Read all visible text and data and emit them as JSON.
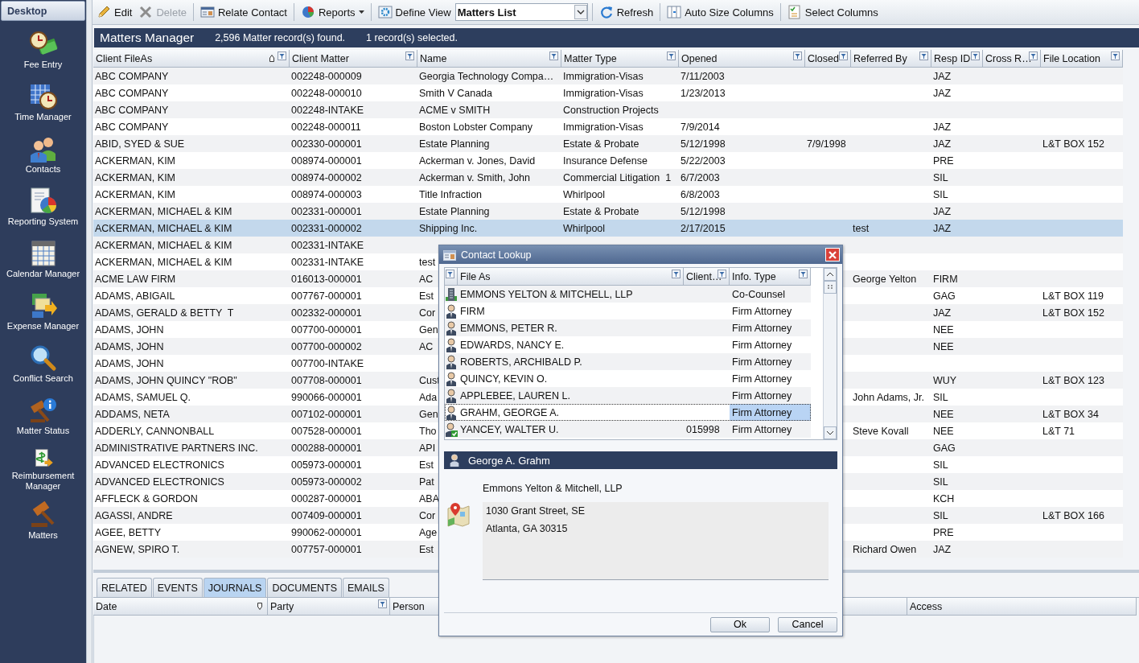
{
  "sidebar": {
    "header": "Desktop",
    "items": [
      {
        "label": "Fee Entry"
      },
      {
        "label": "Time Manager"
      },
      {
        "label": "Contacts"
      },
      {
        "label": "Reporting System"
      },
      {
        "label": "Calendar Manager"
      },
      {
        "label": "Expense Manager"
      },
      {
        "label": "Conflict Search"
      },
      {
        "label": "Matter Status"
      },
      {
        "label": "Reimbursement Manager"
      },
      {
        "label": "Matters"
      }
    ]
  },
  "toolbar": [
    {
      "kind": "button",
      "label": "Edit",
      "disabled": false
    },
    {
      "kind": "button",
      "label": "Delete",
      "disabled": true
    },
    {
      "kind": "button",
      "label": "Relate Contact",
      "disabled": false
    },
    {
      "kind": "dropdown",
      "label": "Reports",
      "disabled": false
    },
    {
      "kind": "button",
      "label": "Define View",
      "disabled": false
    },
    {
      "kind": "combo",
      "label": "Matters List",
      "disabled": false
    },
    {
      "kind": "button",
      "label": "Refresh",
      "disabled": false
    },
    {
      "kind": "button",
      "label": "Auto Size Columns",
      "disabled": false
    },
    {
      "kind": "button",
      "label": "Select Columns",
      "disabled": false
    }
  ],
  "header": {
    "title": "Matters Manager",
    "found": "2,596 Matter record(s) found.",
    "selected": "1 record(s) selected."
  },
  "table": {
    "columns": [
      {
        "label": "Client FileAs",
        "sorted": true
      },
      {
        "label": "Client Matter",
        "sorted": false
      },
      {
        "label": "Name",
        "sorted": false
      },
      {
        "label": "Matter Type",
        "sorted": false
      },
      {
        "label": "Opened",
        "sorted": false
      },
      {
        "label": "Closed",
        "sorted": false
      },
      {
        "label": "Referred By",
        "sorted": false
      },
      {
        "label": "Resp ID",
        "sorted": false
      },
      {
        "label": "Cross R…",
        "sorted": false
      },
      {
        "label": "File Location",
        "sorted": false
      }
    ],
    "rows": [
      {
        "selected": false,
        "cells": [
          "ABC COMPANY",
          "002248-000009",
          "Georgia Technology Compa…",
          "Immigration-Visas",
          "7/11/2003",
          "",
          "",
          "JAZ",
          "",
          ""
        ]
      },
      {
        "selected": false,
        "cells": [
          "ABC COMPANY",
          "002248-000010",
          "Smith V Canada",
          "Immigration-Visas",
          "1/23/2013",
          "",
          "",
          "JAZ",
          "",
          ""
        ]
      },
      {
        "selected": false,
        "cells": [
          "ABC COMPANY",
          "002248-INTAKE",
          "ACME v SMITH",
          "Construction Projects",
          "",
          "",
          "",
          "",
          "",
          ""
        ]
      },
      {
        "selected": false,
        "cells": [
          "ABC COMPANY",
          "002248-000011",
          "Boston Lobster Company",
          "Immigration-Visas",
          "7/9/2014",
          "",
          "",
          "JAZ",
          "",
          ""
        ]
      },
      {
        "selected": false,
        "cells": [
          "ABID, SYED & SUE",
          "002330-000001",
          "Estate Planning",
          "Estate & Probate",
          "5/12/1998",
          "7/9/1998",
          "",
          "JAZ",
          "",
          "L&T BOX 152"
        ]
      },
      {
        "selected": false,
        "cells": [
          "ACKERMAN, KIM",
          "008974-000001",
          "Ackerman v. Jones, David",
          "Insurance Defense",
          "5/22/2003",
          "",
          "",
          "PRE",
          "",
          ""
        ]
      },
      {
        "selected": false,
        "cells": [
          "ACKERMAN, KIM",
          "008974-000002",
          "Ackerman v. Smith, John",
          "Commercial Litigation  1",
          "6/7/2003",
          "",
          "",
          "SIL",
          "",
          ""
        ]
      },
      {
        "selected": false,
        "cells": [
          "ACKERMAN, KIM",
          "008974-000003",
          "Title Infraction",
          "Whirlpool",
          "6/8/2003",
          "",
          "",
          "SIL",
          "",
          ""
        ]
      },
      {
        "selected": false,
        "cells": [
          "ACKERMAN, MICHAEL & KIM",
          "002331-000001",
          "Estate Planning",
          "Estate & Probate",
          "5/12/1998",
          "",
          "",
          "JAZ",
          "",
          ""
        ]
      },
      {
        "selected": true,
        "cells": [
          "ACKERMAN, MICHAEL & KIM",
          "002331-000002",
          "Shipping Inc.",
          "Whirlpool",
          "2/17/2015",
          "",
          "test",
          "JAZ",
          "",
          ""
        ]
      },
      {
        "selected": false,
        "cells": [
          "ACKERMAN, MICHAEL & KIM",
          "002331-INTAKE",
          "",
          "",
          "",
          "",
          "",
          "",
          "",
          ""
        ]
      },
      {
        "selected": false,
        "cells": [
          "ACKERMAN, MICHAEL & KIM",
          "002331-INTAKE",
          "test",
          "",
          "",
          "",
          "",
          "",
          "",
          ""
        ]
      },
      {
        "selected": false,
        "cells": [
          "ACME LAW FIRM",
          "016013-000001",
          "AC",
          "",
          "",
          "",
          "George Yelton",
          "FIRM",
          "",
          ""
        ]
      },
      {
        "selected": false,
        "cells": [
          "ADAMS, ABIGAIL",
          "007767-000001",
          "Est",
          "",
          "",
          "",
          "",
          "GAG",
          "",
          "L&T BOX 119"
        ]
      },
      {
        "selected": false,
        "cells": [
          "ADAMS, GERALD & BETTY  T",
          "002332-000001",
          "Cor",
          "",
          "",
          "",
          "",
          "JAZ",
          "",
          "L&T BOX 152"
        ]
      },
      {
        "selected": false,
        "cells": [
          "ADAMS, JOHN",
          "007700-000001",
          "Gen",
          "",
          "",
          "",
          "",
          "NEE",
          "",
          ""
        ]
      },
      {
        "selected": false,
        "cells": [
          "ADAMS, JOHN",
          "007700-000002",
          "AC",
          "",
          "",
          "",
          "",
          "NEE",
          "",
          ""
        ]
      },
      {
        "selected": false,
        "cells": [
          "ADAMS, JOHN",
          "007700-INTAKE",
          "",
          "",
          "",
          "",
          "",
          "",
          "",
          ""
        ]
      },
      {
        "selected": false,
        "cells": [
          "ADAMS, JOHN QUINCY \"ROB\"",
          "007708-000001",
          "Cust",
          "",
          "",
          "",
          "",
          "WUY",
          "",
          "L&T BOX 123"
        ]
      },
      {
        "selected": false,
        "cells": [
          "ADAMS, SAMUEL Q.",
          "990066-000001",
          "Ada",
          "",
          "",
          "",
          "John Adams, Jr.",
          "SIL",
          "",
          ""
        ]
      },
      {
        "selected": false,
        "cells": [
          "ADDAMS, NETA",
          "007102-000001",
          "Gen",
          "",
          "",
          "",
          "",
          "NEE",
          "",
          "L&T BOX 34"
        ]
      },
      {
        "selected": false,
        "cells": [
          "ADDERLY, CANNONBALL",
          "007528-000001",
          "Tho",
          "",
          "",
          "",
          "Steve Kovall",
          "NEE",
          "",
          "L&T 71"
        ]
      },
      {
        "selected": false,
        "cells": [
          "ADMINISTRATIVE PARTNERS INC.",
          "000288-000001",
          "API",
          "",
          "",
          "",
          "",
          "GAG",
          "",
          ""
        ]
      },
      {
        "selected": false,
        "cells": [
          "ADVANCED ELECTRONICS",
          "005973-000001",
          "Est",
          "",
          "",
          "",
          "",
          "SIL",
          "",
          ""
        ]
      },
      {
        "selected": false,
        "cells": [
          "ADVANCED ELECTRONICS",
          "005973-000002",
          "Pat",
          "",
          "",
          "",
          "",
          "SIL",
          "",
          ""
        ]
      },
      {
        "selected": false,
        "cells": [
          "AFFLECK & GORDON",
          "000287-000001",
          "ABA",
          "",
          "",
          "",
          "",
          "KCH",
          "",
          ""
        ]
      },
      {
        "selected": false,
        "cells": [
          "AGASSI, ANDRE",
          "007409-000001",
          "Cor",
          "",
          "",
          "",
          "",
          "SIL",
          "",
          "L&T BOX 166"
        ]
      },
      {
        "selected": false,
        "cells": [
          "AGEE, BETTY",
          "990062-000001",
          "Age",
          "",
          "",
          "",
          "",
          "PRE",
          "",
          ""
        ]
      },
      {
        "selected": false,
        "cells": [
          "AGNEW, SPIRO T.",
          "007757-000001",
          "Est",
          "",
          "",
          "",
          "Richard Owen",
          "JAZ",
          "",
          ""
        ]
      }
    ]
  },
  "tabs": [
    {
      "label": "RELATED",
      "selected": false
    },
    {
      "label": "EVENTS",
      "selected": false
    },
    {
      "label": "JOURNALS",
      "selected": true
    },
    {
      "label": "DOCUMENTS",
      "selected": false
    },
    {
      "label": "EMAILS",
      "selected": false
    }
  ],
  "journal_columns": [
    {
      "label": "Date",
      "sorted": true
    },
    {
      "label": "Party",
      "sorted": false
    },
    {
      "label": "Person",
      "sorted": false
    },
    {
      "label": "Access",
      "sorted": false
    }
  ],
  "dialog": {
    "title": "Contact Lookup",
    "columns": [
      {
        "label": "File As"
      },
      {
        "label": "Client…"
      },
      {
        "label": "Info. Type"
      }
    ],
    "rows": [
      {
        "kind": "company",
        "file_as": "EMMONS YELTON & MITCHELL, LLP",
        "client": "",
        "info_type": "Co-Counsel",
        "selected": false
      },
      {
        "kind": "person",
        "file_as": "FIRM",
        "client": "",
        "info_type": "Firm Attorney",
        "selected": false
      },
      {
        "kind": "person",
        "file_as": "EMMONS, PETER R.",
        "client": "",
        "info_type": "Firm Attorney",
        "selected": false
      },
      {
        "kind": "person",
        "file_as": "EDWARDS, NANCY E.",
        "client": "",
        "info_type": "Firm Attorney",
        "selected": false
      },
      {
        "kind": "person",
        "file_as": "ROBERTS, ARCHIBALD P.",
        "client": "",
        "info_type": "Firm Attorney",
        "selected": false
      },
      {
        "kind": "person",
        "file_as": "QUINCY, KEVIN O.",
        "client": "",
        "info_type": "Firm Attorney",
        "selected": false
      },
      {
        "kind": "person",
        "file_as": "APPLEBEE, LAUREN L.",
        "client": "",
        "info_type": "Firm Attorney",
        "selected": false
      },
      {
        "kind": "person",
        "file_as": "GRAHM, GEORGE A.",
        "client": "",
        "info_type": "Firm Attorney",
        "selected": true
      },
      {
        "kind": "verified",
        "file_as": "YANCEY, WALTER U.",
        "client": "015998",
        "info_type": "Firm Attorney",
        "selected": false
      }
    ],
    "contact": {
      "name": "George A. Grahm",
      "company": "Emmons Yelton & Mitchell, LLP",
      "address": [
        "1030 Grant Street, SE",
        "Atlanta, GA 30315"
      ]
    },
    "buttons": [
      "Ok",
      "Cancel"
    ]
  }
}
